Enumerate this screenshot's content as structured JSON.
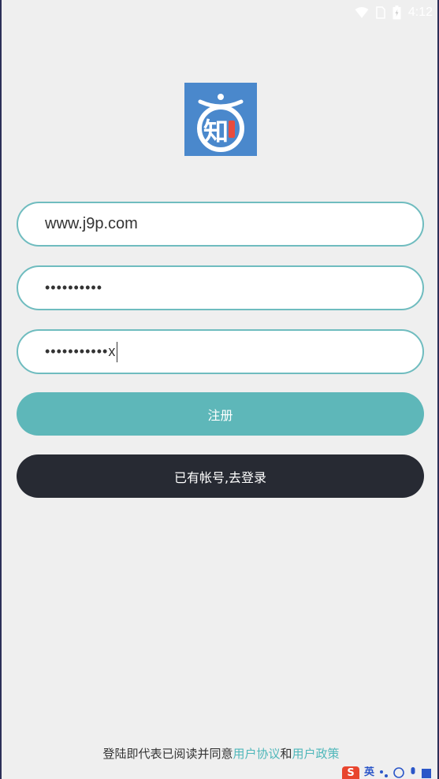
{
  "status_bar": {
    "time": "4:12",
    "icons": [
      "wifi-icon",
      "sim-icon",
      "battery-icon"
    ]
  },
  "logo": {
    "glyph": "知"
  },
  "form": {
    "username_value": "www.j9p.com",
    "password_value": "••••••••••",
    "confirm_password_value": "•••••••••••x"
  },
  "buttons": {
    "register_label": "注册",
    "login_label": "已有帐号,去登录"
  },
  "agreement": {
    "prefix": "登陆即代表已阅读并同意",
    "user_agreement": "用户协议",
    "joiner": "和",
    "user_policy": "用户政策"
  },
  "ime": {
    "mode_label": "英"
  },
  "colors": {
    "background": "#efefef",
    "accent": "#5eb7b9",
    "field_border": "#6fbcbf",
    "dark_button": "#272a33",
    "logo_bg": "#4a88cc",
    "link": "#4fb7ba"
  }
}
